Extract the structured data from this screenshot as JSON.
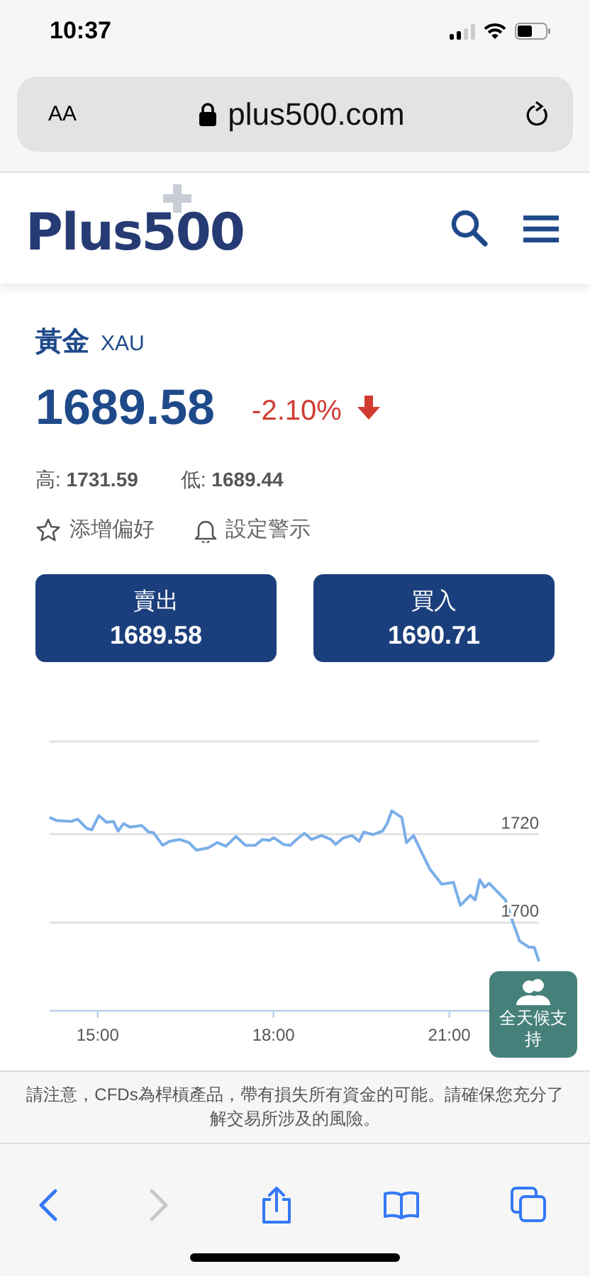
{
  "status_bar": {
    "time": "10:37"
  },
  "browser": {
    "text_size_button": "AA",
    "url": "plus500.com"
  },
  "header": {
    "logo": "Plus500"
  },
  "instrument": {
    "name": "黃金",
    "symbol": "XAU",
    "price": "1689.58",
    "change": "-2.10%",
    "falling": true,
    "high_label": "高:",
    "high": "1731.59",
    "low_label": "低:",
    "low": "1689.44",
    "actions": [
      {
        "kind": "favorite",
        "label": "添增偏好"
      },
      {
        "kind": "alert",
        "label": "設定警示"
      }
    ],
    "trade_buttons": [
      {
        "label": "賣出",
        "price": "1689.58"
      },
      {
        "label": "買入",
        "price": "1690.71"
      }
    ]
  },
  "chart": {
    "chart_data": {
      "type": "line",
      "x": [
        14.18,
        14.3,
        14.54,
        14.66,
        14.82,
        14.9,
        15.02,
        15.15,
        15.27,
        15.35,
        15.44,
        15.55,
        15.75,
        15.87,
        15.95,
        16.11,
        16.23,
        16.4,
        16.56,
        16.68,
        16.88,
        17.04,
        17.19,
        17.36,
        17.52,
        17.69,
        17.81,
        17.93,
        18.01,
        18.17,
        18.29,
        18.41,
        18.53,
        18.65,
        18.82,
        18.98,
        19.06,
        19.18,
        19.34,
        19.46,
        19.54,
        19.7,
        19.86,
        19.94,
        20.02,
        20.19,
        20.27,
        20.39,
        20.51,
        20.67,
        20.87,
        21.07,
        21.19,
        21.36,
        21.44,
        21.52,
        21.6,
        21.68,
        21.96,
        22.08,
        22.2,
        22.36,
        22.45,
        22.53
      ],
      "series": [
        {
          "color": "#7aaee8",
          "values": [
            1723.8,
            1723.1,
            1722.9,
            1723.4,
            1721.3,
            1721.0,
            1724.2,
            1722.7,
            1722.9,
            1720.7,
            1722.4,
            1721.6,
            1722.0,
            1720.5,
            1720.4,
            1717.5,
            1718.4,
            1718.8,
            1718.1,
            1716.4,
            1716.9,
            1718.1,
            1717.3,
            1719.5,
            1717.5,
            1717.5,
            1718.8,
            1718.6,
            1719.2,
            1717.7,
            1717.5,
            1719.0,
            1720.2,
            1718.8,
            1719.7,
            1718.8,
            1717.7,
            1719.1,
            1719.7,
            1718.4,
            1720.5,
            1719.9,
            1720.7,
            1722.4,
            1725.3,
            1723.8,
            1718.1,
            1719.7,
            1716.4,
            1712.1,
            1708.7,
            1709.1,
            1703.9,
            1706.2,
            1705.1,
            1709.7,
            1708.0,
            1708.9,
            1705.1,
            1700.3,
            1695.8,
            1694.4,
            1694.4,
            1691.2
          ]
        }
      ],
      "xlim": [
        14.18,
        22.53
      ],
      "ylim": [
        1680,
        1741
      ],
      "xticks": [
        {
          "value": 15,
          "label": "15:00"
        },
        {
          "value": 18,
          "label": "18:00"
        },
        {
          "value": 21,
          "label": "21:00"
        }
      ],
      "yticks": [
        1700,
        1720
      ]
    }
  },
  "support_button": {
    "label": "全天候支持"
  },
  "disclaimer": "請注意，CFDs為桿槓產品，帶有損失所有資金的可能。請確保您充分了解交易所涉及的風險。",
  "toolbar": [
    {
      "kind": "back",
      "disabled": false
    },
    {
      "kind": "forward",
      "disabled": true
    },
    {
      "kind": "share",
      "disabled": false
    },
    {
      "kind": "bookmarks",
      "disabled": false
    },
    {
      "kind": "tabs",
      "disabled": false
    }
  ]
}
